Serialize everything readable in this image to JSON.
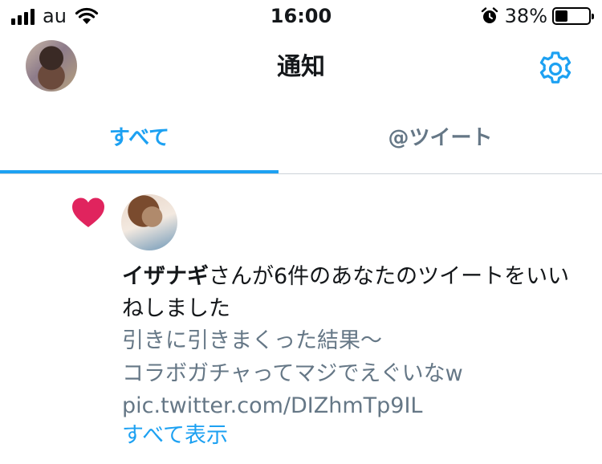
{
  "status_bar": {
    "carrier": "au",
    "time": "16:00",
    "battery_percent": "38%",
    "battery_level": 0.38
  },
  "header": {
    "title": "通知",
    "settings_icon": "gear-icon"
  },
  "tabs": [
    {
      "label": "すべて",
      "selected": true
    },
    {
      "label": "@ツイート",
      "selected": false
    }
  ],
  "notification": {
    "type": "like",
    "user_name": "イザナギ",
    "message_rest": "さんが6件のあなたのツイートをいいねしました",
    "tweet_lines": [
      "引きに引きまくった結果〜",
      "コラボガチャってマジでえぐいなw",
      "pic.twitter.com/DIZhmTp9IL"
    ],
    "show_all_label": "すべて表示"
  },
  "colors": {
    "accent": "#1da1f2",
    "like": "#e0245e",
    "secondary_text": "#657786"
  }
}
